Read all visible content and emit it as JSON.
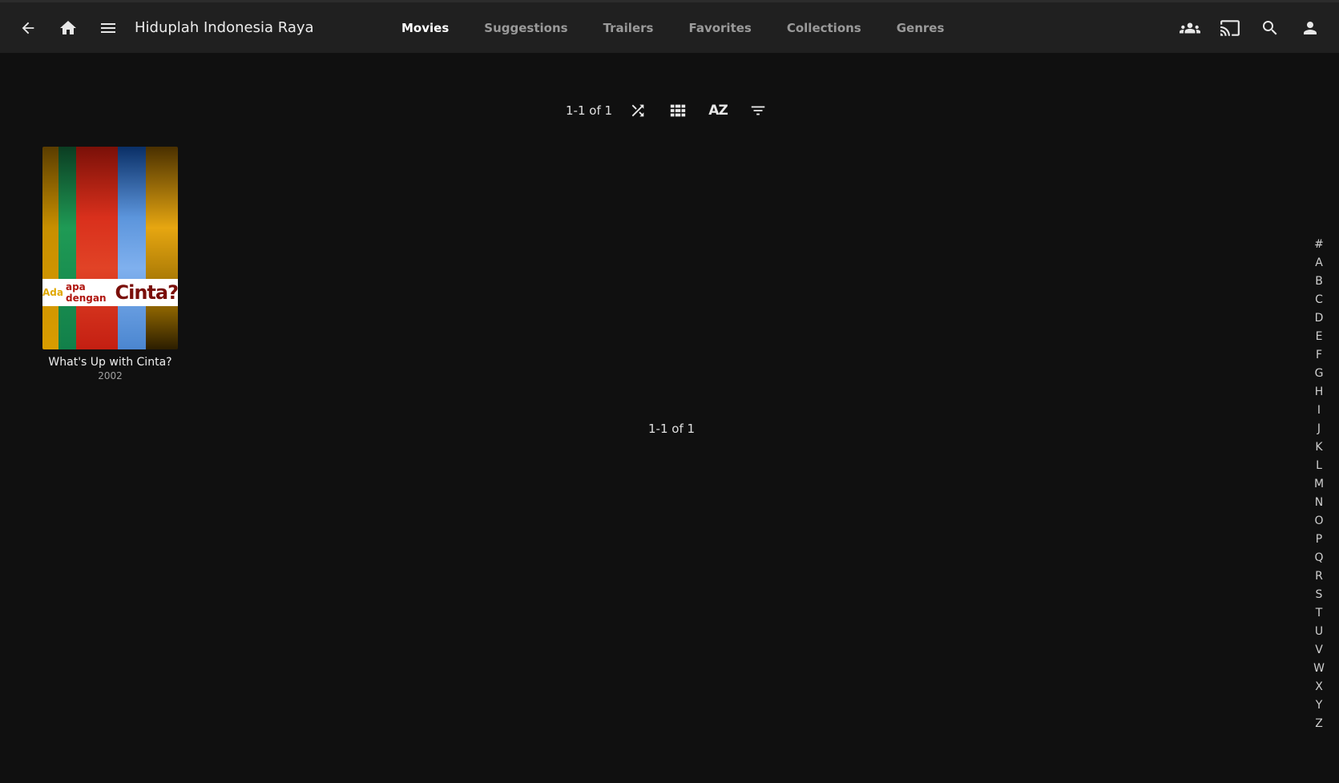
{
  "header": {
    "title": "Hiduplah Indonesia Raya",
    "icons": [
      "back-arrow-icon",
      "home-icon",
      "menu-icon",
      "users-icon",
      "cast-icon",
      "search-icon",
      "user-icon"
    ],
    "tabs": [
      {
        "label": "Movies",
        "active": true
      },
      {
        "label": "Suggestions",
        "active": false
      },
      {
        "label": "Trailers",
        "active": false
      },
      {
        "label": "Favorites",
        "active": false
      },
      {
        "label": "Collections",
        "active": false
      },
      {
        "label": "Genres",
        "active": false
      }
    ]
  },
  "toolbar": {
    "count": "1-1 of 1",
    "sort_label": "AZ",
    "icons": [
      "shuffle-icon",
      "grid-view-icon",
      "sort-az-icon",
      "filter-icon"
    ]
  },
  "items": [
    {
      "title": "What's Up with Cinta?",
      "year": "2002",
      "poster_text": {
        "small1": "Ada",
        "small2": "apa dengan",
        "big": "Cinta?"
      }
    }
  ],
  "footer": {
    "count": "1-1 of 1"
  },
  "alphabet": [
    "#",
    "A",
    "B",
    "C",
    "D",
    "E",
    "F",
    "G",
    "H",
    "I",
    "J",
    "K",
    "L",
    "M",
    "N",
    "O",
    "P",
    "Q",
    "R",
    "S",
    "T",
    "U",
    "V",
    "W",
    "X",
    "Y",
    "Z"
  ],
  "colors": {
    "background": "#101010",
    "header": "#202020",
    "active_tab": "#ffffff",
    "inactive_tab": "#9a9a9a"
  }
}
